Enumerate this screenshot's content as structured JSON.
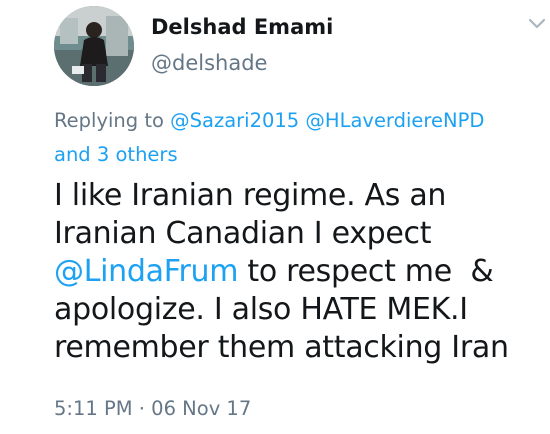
{
  "author": {
    "display_name": "Delshad Emami",
    "handle": "@delshade"
  },
  "reply_context": {
    "prefix": "Replying to ",
    "mention_1": "@Sazari2015",
    "separator": " ",
    "mention_2": "@HLaverdiereNPD",
    "others": "and 3 others"
  },
  "tweet": {
    "line_1": "I like Iranian regime. As an",
    "line_2": "Iranian Canadian I expect",
    "line_3_mention": "@LindaFrum",
    "line_3_rest": " to respect me  &",
    "line_4": "apologize. I also HATE MEK.I",
    "line_5": "remember them attacking Iran"
  },
  "timestamp": "5:11 PM · 06 Nov 17",
  "icons": {
    "menu": "chevron-down-icon"
  },
  "colors": {
    "text": "#14171a",
    "secondary": "#657786",
    "link": "#1da1f2"
  }
}
